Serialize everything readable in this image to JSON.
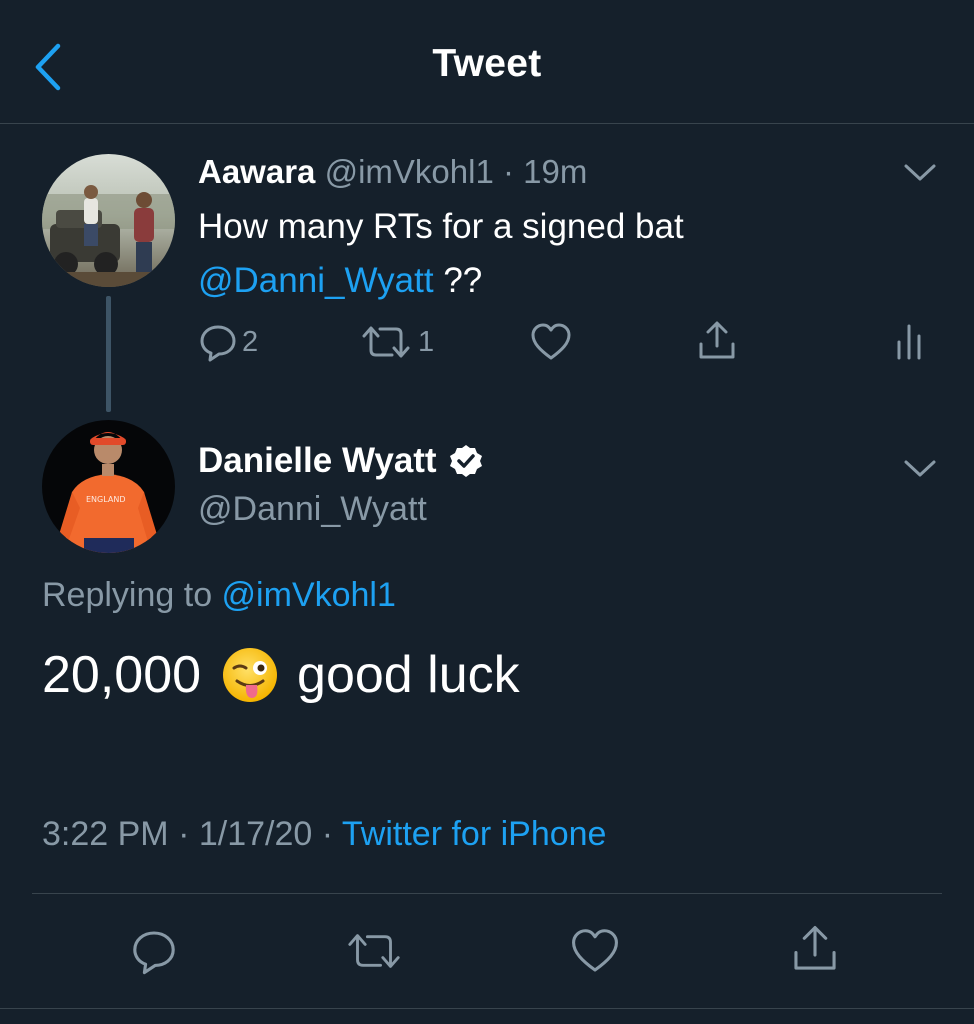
{
  "header": {
    "title": "Tweet",
    "back_icon": "chevron-left-icon"
  },
  "colors": {
    "background": "#15202b",
    "accent": "#1da1f2",
    "muted": "#8899a6",
    "divider": "#38444d"
  },
  "parent_tweet": {
    "author_name": "Aawara",
    "handle": "@imVkohl1",
    "separator": "·",
    "time": "19m",
    "text": "How many RTs for a signed bat",
    "mention": "@Danni_Wyatt",
    "text_suffix": " ??",
    "actions": {
      "reply_count": "2",
      "retweet_count": "1"
    }
  },
  "main_tweet": {
    "author_name": "Danielle Wyatt",
    "handle": "@Danni_Wyatt",
    "replying_prefix": "Replying to ",
    "replying_to": "@imVkohl1",
    "text_before": "20,000",
    "emoji": "winking-face-with-tongue",
    "text_after": "good luck",
    "time": "3:22 PM",
    "sep1": " · ",
    "date": "1/17/20",
    "sep2": " · ",
    "source": "Twitter for iPhone"
  }
}
